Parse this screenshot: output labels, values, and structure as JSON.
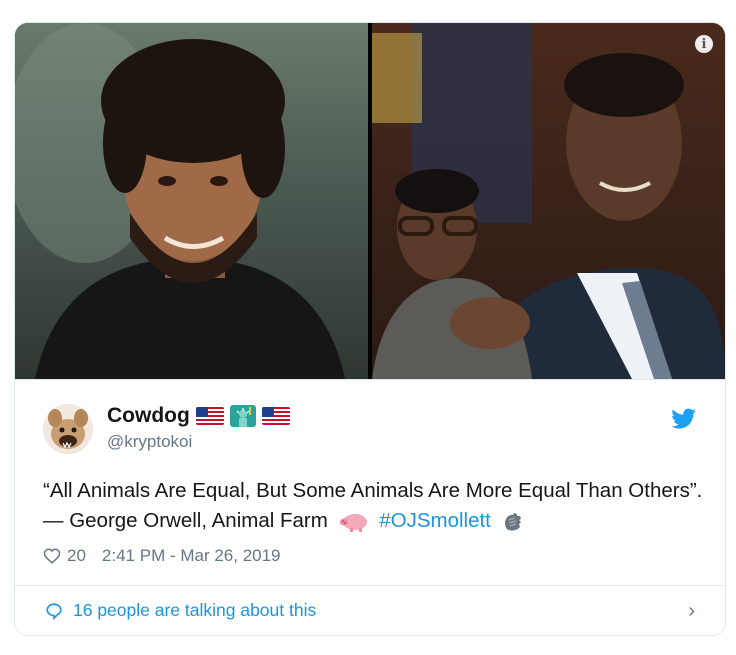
{
  "tweet": {
    "author_name": "Cowdog",
    "author_handle": "@kryptokoi",
    "text_before": "“All Animals Are Equal, But Some Animals Are More Equal Than Others”.  — George Orwell, Animal Farm",
    "hashtag": "#OJSmollett",
    "likes": "20",
    "timestamp": "2:41 PM - Mar 26, 2019"
  },
  "footer": {
    "talking_text": "16 people are talking about this"
  },
  "media": {
    "info_glyph": "i"
  },
  "colors": {
    "link": "#1b95e0",
    "muted": "#657786",
    "border": "#e1e8ed"
  }
}
